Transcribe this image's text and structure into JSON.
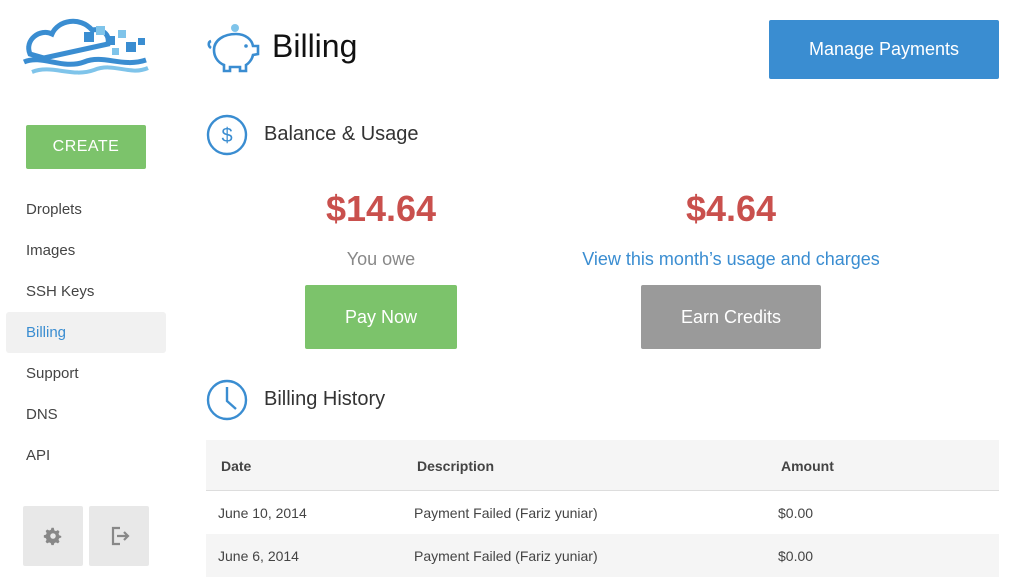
{
  "app": {
    "logo": "digitalocean-logo"
  },
  "sidebar": {
    "create_label": "CREATE",
    "items": [
      {
        "label": "Droplets"
      },
      {
        "label": "Images"
      },
      {
        "label": "SSH Keys"
      },
      {
        "label": "Billing",
        "active": true
      },
      {
        "label": "Support"
      },
      {
        "label": "DNS"
      },
      {
        "label": "API"
      }
    ],
    "settings_icon": "gear-icon",
    "logout_icon": "logout-icon"
  },
  "header": {
    "icon": "piggy-bank-icon",
    "title": "Billing",
    "manage_label": "Manage Payments"
  },
  "balance": {
    "icon": "dollar-icon",
    "title": "Balance & Usage",
    "owed_amount": "$14.64",
    "owed_label": "You owe",
    "pay_label": "Pay Now",
    "usage_amount": "$4.64",
    "usage_link": "View this month’s usage and charges",
    "earn_label": "Earn Credits"
  },
  "history": {
    "icon": "clock-icon",
    "title": "Billing History",
    "columns": [
      "Date",
      "Description",
      "Amount"
    ],
    "rows": [
      {
        "date": "June 10, 2014",
        "description": "Payment Failed (Fariz yuniar)",
        "amount": "$0.00"
      },
      {
        "date": "June 6, 2014",
        "description": "Payment Failed (Fariz yuniar)",
        "amount": "$0.00"
      }
    ]
  },
  "colors": {
    "accent_blue": "#3a8dd1",
    "create_green": "#7cc36b",
    "amount_red": "#c9504d",
    "neutral_gray": "#9a9a9a"
  }
}
